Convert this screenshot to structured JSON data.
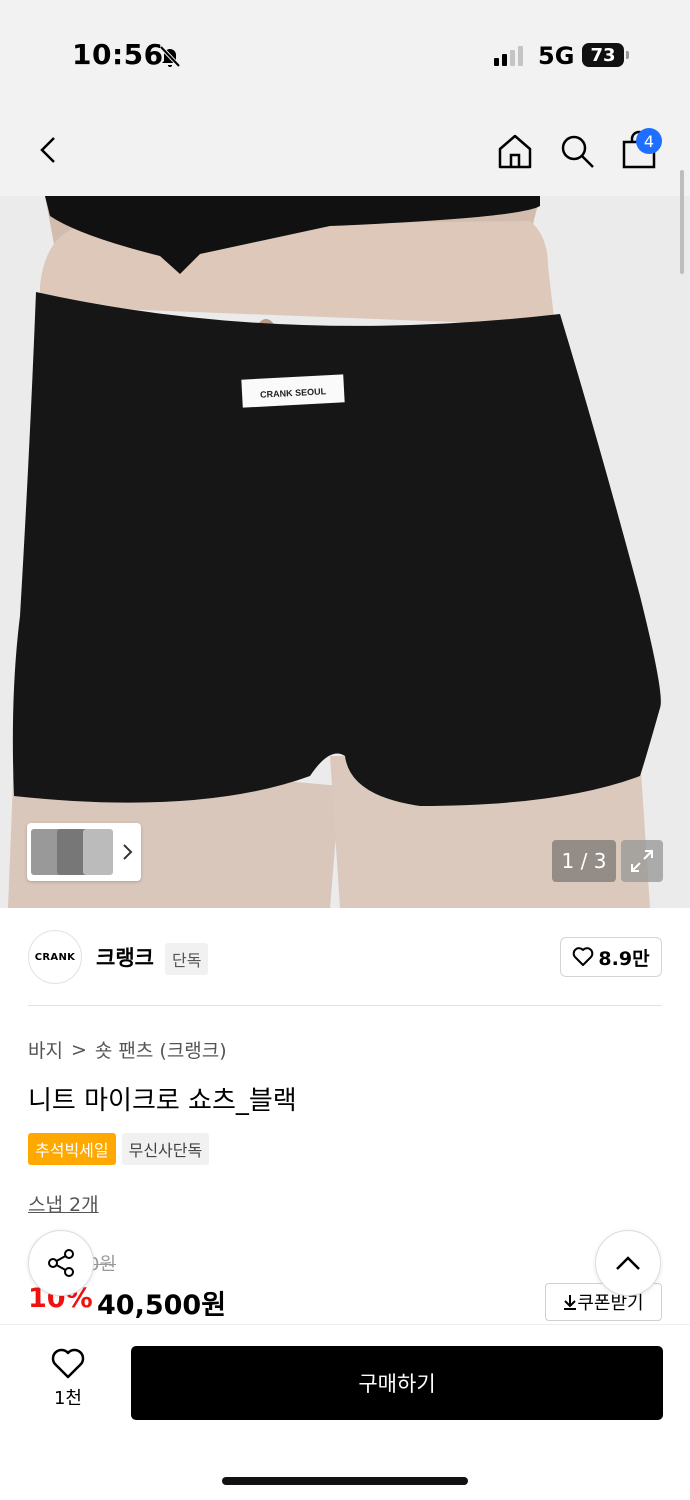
{
  "status_bar": {
    "time": "10:56",
    "network": "5G",
    "battery": "73"
  },
  "header": {
    "cart_count": "4"
  },
  "gallery": {
    "label_text": "CRANK SEOUL",
    "counter": "1 / 3"
  },
  "brand": {
    "logo_text": "CRANK",
    "name": "크랭크",
    "tag": "단독",
    "like_count": "8.9만"
  },
  "breadcrumb": {
    "category": "바지",
    "separator": ">",
    "subcategory": "숏 팬츠 (크랭크)"
  },
  "product": {
    "title": "니트 마이크로 쇼츠_블랙",
    "tags": [
      "추석빅세일",
      "무신사단독"
    ],
    "snap": "스냅 2개",
    "original_price": "0원",
    "discount": "10%",
    "price": "40,500원",
    "coupon_label": "쿠폰받기"
  },
  "bottom_bar": {
    "wish_count": "1천",
    "buy_label": "구매하기"
  },
  "colors": {
    "accent_blue": "#1e6eff",
    "sale_orange": "#ffa800",
    "discount_red": "#f31110"
  }
}
